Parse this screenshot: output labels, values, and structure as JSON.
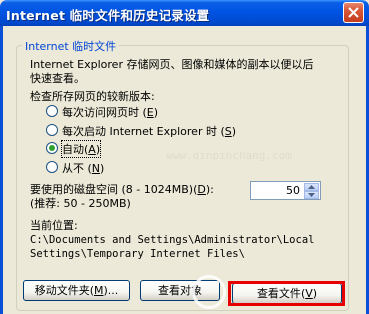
{
  "window": {
    "title": "Internet 临时文件和历史记录设置",
    "close_icon": "close-icon"
  },
  "group": {
    "legend": "Internet 临时文件",
    "description_line1": "Internet Explorer 存储网页、图像和媒体的副本以便以后",
    "description_line2": "快速查看。"
  },
  "check_newer": {
    "label": "检查所存网页的较新版本:",
    "options": [
      {
        "label": "每次访问网页时",
        "accel": "E",
        "selected": false
      },
      {
        "label": "每次启动 Internet Explorer 时",
        "accel": "S",
        "selected": false
      },
      {
        "label": "自动",
        "accel": "A",
        "selected": true
      },
      {
        "label": "从不",
        "accel": "N",
        "selected": false
      }
    ]
  },
  "disk_space": {
    "label_line1": "要使用的磁盘空间 (8 - 1024MB)",
    "accel": "D",
    "label_tail": ":",
    "label_line2": "(推荐: 50 - 250MB)",
    "value": "50"
  },
  "location": {
    "label": "当前位置:",
    "path_line1": "C:\\Documents and Settings\\Administrator\\Local",
    "path_line2": "Settings\\Temporary Internet Files\\"
  },
  "buttons": {
    "move_folder": "移动文件夹",
    "move_folder_accel": "M",
    "move_folder_tail": "...",
    "view_objects": "查看对象",
    "view_files": "查看文件",
    "view_files_accel": "V"
  },
  "watermark": "www.qinpinchang.com",
  "colors": {
    "title_blue": "#0054e3",
    "dialog_bg": "#ece9d8",
    "legend_blue": "#0046d5",
    "highlight_red": "#e60000",
    "radio_green": "#2fa22f"
  }
}
